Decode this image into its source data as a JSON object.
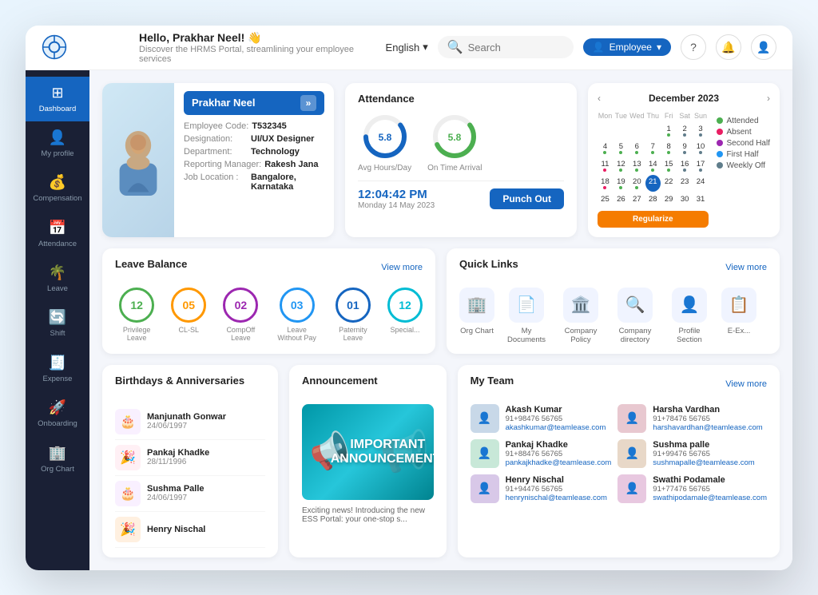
{
  "header": {
    "logo_symbol": "◎",
    "greeting": "Hello, Prakhar Neel! 👋",
    "subtitle": "Discover the HRMS Portal, streamlining your employee services",
    "language": "English",
    "search_placeholder": "Search",
    "employee_label": "Employee",
    "help_icon": "?",
    "bell_icon": "🔔",
    "user_icon": "👤"
  },
  "sidebar": {
    "items": [
      {
        "id": "dashboard",
        "label": "Dashboard",
        "icon": "⊞",
        "active": true
      },
      {
        "id": "my-profile",
        "label": "My Profile",
        "icon": "👤",
        "active": false
      },
      {
        "id": "compensation",
        "label": "Compensation",
        "icon": "💰",
        "active": false
      },
      {
        "id": "attendance",
        "label": "Attendance",
        "icon": "📅",
        "active": false
      },
      {
        "id": "leave",
        "label": "Leave",
        "icon": "🌴",
        "active": false
      },
      {
        "id": "shift",
        "label": "Shift",
        "icon": "🔄",
        "active": false
      },
      {
        "id": "expense",
        "label": "Expense",
        "icon": "🧾",
        "active": false
      },
      {
        "id": "onboarding",
        "label": "Onboarding",
        "icon": "🚀",
        "active": false
      },
      {
        "id": "org-chart",
        "label": "Org Chart",
        "icon": "🏢",
        "active": false
      }
    ]
  },
  "profile": {
    "name": "Prakhar Neel",
    "employee_code_label": "Employee Code:",
    "employee_code": "T532345",
    "designation_label": "Designation:",
    "designation": "UI/UX Designer",
    "department_label": "Department:",
    "department": "Technology",
    "reporting_manager_label": "Reporting Manager:",
    "reporting_manager": "Rakesh Jana",
    "job_location_label": "Job Location :",
    "job_location": "Bangalore, Karnataka"
  },
  "attendance": {
    "title": "Attendance",
    "avg_hours_label": "Avg Hours/Day",
    "avg_hours_value": "5.8",
    "on_time_label": "On Time Arrival",
    "on_time_value": "5.8",
    "time": "12:04:42 PM",
    "date": "Monday 14 May 2023",
    "punch_btn": "Punch Out"
  },
  "calendar": {
    "title": "December 2023",
    "days_header": [
      "Mon",
      "Tue",
      "Wed",
      "Thu",
      "Fri",
      "Sat",
      "Sun"
    ],
    "weeks": [
      [
        "",
        "",
        "",
        "",
        "1",
        "2",
        "3"
      ],
      [
        "4",
        "5",
        "6",
        "7",
        "8",
        "9",
        "10"
      ],
      [
        "11",
        "12",
        "13",
        "14",
        "15",
        "16",
        "17"
      ],
      [
        "18",
        "19",
        "20",
        "21",
        "22",
        "23",
        "24"
      ],
      [
        "25",
        "26",
        "27",
        "28",
        "29",
        "30",
        "31"
      ]
    ],
    "today": "21",
    "legend": [
      {
        "label": "Attended",
        "color": "#4caf50"
      },
      {
        "label": "Absent",
        "color": "#e91e63"
      },
      {
        "label": "Second Half",
        "color": "#9c27b0"
      },
      {
        "label": "First Half",
        "color": "#2196f3"
      },
      {
        "label": "Weekly Off",
        "color": "#607d8b"
      }
    ],
    "regularize_btn": "Regularize"
  },
  "leave_balance": {
    "title": "Leave Balance",
    "view_more": "View more",
    "items": [
      {
        "label": "Privilege Leave",
        "count": "12",
        "color": "#4caf50"
      },
      {
        "label": "CL-SL",
        "count": "05",
        "color": "#ff9800"
      },
      {
        "label": "CompOff Leave",
        "count": "02",
        "color": "#9c27b0"
      },
      {
        "label": "Leave Without Pay",
        "count": "03",
        "color": "#2196f3"
      },
      {
        "label": "Paternity Leave",
        "count": "01",
        "color": "#1565c0"
      },
      {
        "label": "Special...",
        "count": "12",
        "color": "#00bcd4"
      }
    ]
  },
  "quick_links": {
    "title": "Quick Links",
    "view_more": "View more",
    "items": [
      {
        "label": "Org Chart",
        "icon": "🏢"
      },
      {
        "label": "My Documents",
        "icon": "📄"
      },
      {
        "label": "Company Policy",
        "icon": "🏛️"
      },
      {
        "label": "Company directory",
        "icon": "🔍"
      },
      {
        "label": "Profile Section",
        "icon": "👤"
      },
      {
        "label": "E-Ex...",
        "icon": "📋"
      }
    ]
  },
  "birthdays": {
    "title": "Birthdays & Anniversaries",
    "items": [
      {
        "name": "Manjunath Gonwar",
        "date": "24/06/1997",
        "icon": "🎂"
      },
      {
        "name": "Pankaj Khadke",
        "date": "28/11/1996",
        "icon": "🎉"
      },
      {
        "name": "Sushma Palle",
        "date": "24/06/1997",
        "icon": "🎂"
      },
      {
        "name": "Henry Nischal",
        "date": "",
        "icon": "🎉"
      }
    ]
  },
  "announcement": {
    "title": "Announcement",
    "banner_text": "IMPORTANT ANNOUNCEMENT!",
    "footer_text": "Exciting news! Introducing the new ESS Portal: your one-stop s..."
  },
  "my_team": {
    "title": "My Team",
    "view_more": "View more",
    "members": [
      {
        "name": "Akash Kumar",
        "phone": "91+98476 56765",
        "email": "akashkumar@teamlease.com",
        "avatar_color": "#c8d8e8"
      },
      {
        "name": "Harsha Vardhan",
        "phone": "91+78476 56765",
        "email": "harshavardhan@teamlease.com",
        "avatar_color": "#e8c8d0"
      },
      {
        "name": "Pankaj Khadke",
        "phone": "91+88476 56765",
        "email": "pankajkhadke@teamlease.com",
        "avatar_color": "#c8e8d8"
      },
      {
        "name": "Sushma palle",
        "phone": "91+99476 56765",
        "email": "sushmapalle@teamlease.com",
        "avatar_color": "#e8d8c8"
      },
      {
        "name": "Henry Nischal",
        "phone": "91+94476 56765",
        "email": "henrynischal@teamlease.com",
        "avatar_color": "#d8c8e8"
      },
      {
        "name": "Swathi Podamale",
        "phone": "91+77476 56765",
        "email": "swathipodamale@teamlease.com",
        "avatar_color": "#e8c8e0"
      }
    ]
  }
}
